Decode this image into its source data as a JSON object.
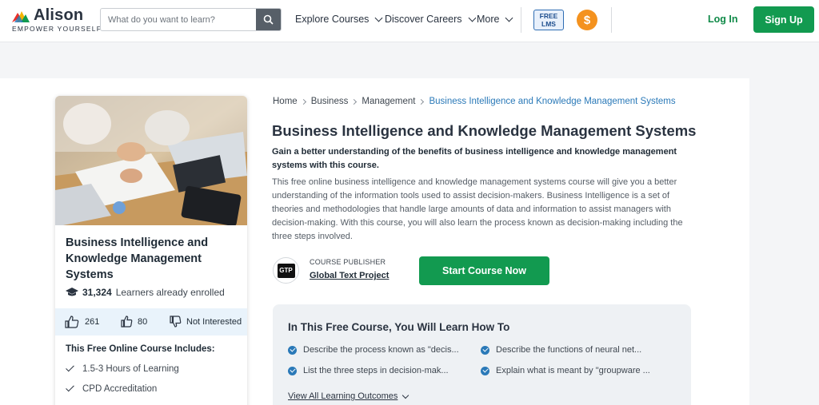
{
  "header": {
    "logo_name": "Alison",
    "logo_tagline": "EMPOWER YOURSELF",
    "search_placeholder": "What do you want to learn?",
    "nav": [
      {
        "label": "Explore Courses"
      },
      {
        "label": "Discover Careers"
      },
      {
        "label": "More"
      }
    ],
    "free_lms_line1": "FREE",
    "free_lms_line2": "LMS",
    "coin_symbol": "$",
    "login_label": "Log In",
    "signup_label": "Sign Up"
  },
  "course_card": {
    "title": "Business Intelligence and Knowledge Management Systems",
    "learners_count": "31,324",
    "learners_label": "Learners already enrolled",
    "likes": "261",
    "upvotes": "80",
    "not_interested_label": "Not Interested",
    "includes_title": "This Free Online Course Includes:",
    "includes": [
      "1.5-3 Hours of Learning",
      "CPD Accreditation"
    ]
  },
  "breadcrumb": [
    "Home",
    "Business",
    "Management",
    "Business Intelligence and Knowledge Management Systems"
  ],
  "course": {
    "title": "Business Intelligence and Knowledge Management Systems",
    "subtitle": "Gain a better understanding of the benefits of business intelligence and knowledge management systems with this course.",
    "description": "This free online business intelligence and knowledge management systems course will give you a better understanding of the information tools used to assist decision-makers. Business Intelligence is a set of theories and methodologies that handle large amounts of data and information to assist managers with decision-making. With this course, you will also learn the process known as decision-making including the three steps involved.",
    "publisher_label": "COURSE PUBLISHER",
    "publisher_name": "Global Text Project",
    "publisher_logo_text": "GTP",
    "start_label": "Start Course Now"
  },
  "learn": {
    "title": "In This Free Course, You Will Learn How To",
    "outcomes": [
      "Describe the process known as \"decis...",
      "Describe the functions of neural net...",
      "List the three steps in decision-mak...",
      "Explain what is meant by \"groupware ..."
    ],
    "view_all_label": "View All Learning Outcomes"
  },
  "colors": {
    "brand_green": "#129a50",
    "link_blue": "#2a79b8",
    "coin_orange": "#f4921f"
  }
}
